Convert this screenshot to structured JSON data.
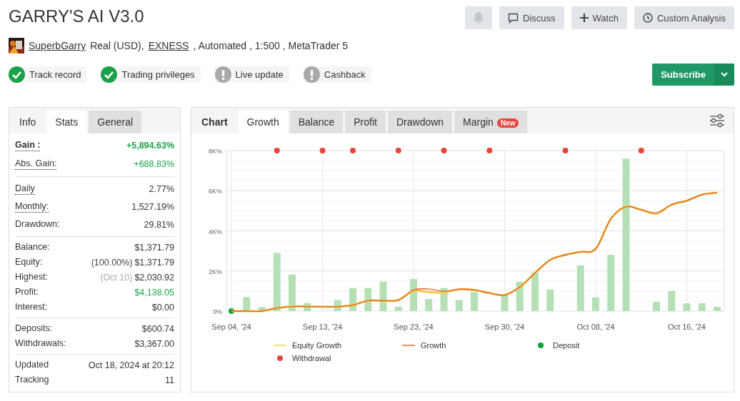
{
  "title": "GARRY'S AI V3.0",
  "header_buttons": [
    {
      "kind": "bell",
      "disabled": true
    },
    {
      "kind": "discuss",
      "label": "Discuss",
      "disabled": false
    },
    {
      "kind": "watch",
      "label": "Watch",
      "disabled": false
    },
    {
      "kind": "analysis",
      "label": "Custom Analysis",
      "disabled": false
    }
  ],
  "account": {
    "parts": [
      {
        "text": "SuperbGarry",
        "link": true
      },
      {
        "text": "Real (USD),",
        "link": false
      },
      {
        "text": "EXNESS",
        "link": true
      },
      {
        "text": ", Automated , 1:500 , MetaTrader 5",
        "link": false
      }
    ]
  },
  "badges": [
    {
      "label": "Track record",
      "verified": true
    },
    {
      "label": "Trading privileges",
      "verified": true
    },
    {
      "label": "Live update",
      "verified": false
    },
    {
      "label": "Cashback",
      "verified": false
    }
  ],
  "subscribe_button": {
    "label": "Subscribe"
  },
  "info_panel": {
    "title": "Info",
    "tabs": [
      {
        "label": "Stats",
        "selected": true
      },
      {
        "label": "General",
        "selected": false
      }
    ],
    "groups": [
      [
        {
          "label": "Gain :",
          "value": "+5,894.63%",
          "underlined": true,
          "emphasis": true,
          "positive": true
        },
        {
          "label": "Abs. Gain:",
          "value": "+688.83%",
          "underlined": true,
          "emphasis": false,
          "positive": true
        }
      ],
      [
        {
          "label": "Daily",
          "value": "2.77%",
          "underlined": true,
          "emphasis": false,
          "positive": false
        },
        {
          "label": "Monthly:",
          "value": "1,527.19%",
          "underlined": true,
          "emphasis": false,
          "positive": false
        },
        {
          "label": "Drawdown:",
          "value": "29.81%",
          "underlined": false,
          "emphasis": false,
          "positive": false
        }
      ],
      [
        {
          "label": "Balance:",
          "value": "$1,371.79",
          "underlined": false,
          "emphasis": false,
          "positive": false
        },
        {
          "label": "Equity:",
          "note": "(100.00%)",
          "note_muted": false,
          "value": "$1,371.79",
          "underlined": false,
          "emphasis": false,
          "positive": false
        },
        {
          "label": "Highest:",
          "note": "(Oct 10)",
          "note_muted": true,
          "value": "$2,030.92",
          "underlined": false,
          "emphasis": false,
          "positive": false
        },
        {
          "label": "Profit:",
          "value": "$4,138.05",
          "underlined": false,
          "emphasis": false,
          "positive": true
        },
        {
          "label": "Interest:",
          "value": "$0.00",
          "underlined": false,
          "emphasis": false,
          "positive": false
        }
      ],
      [
        {
          "label": "Deposits:",
          "value": "$600.74",
          "underlined": false,
          "emphasis": false,
          "positive": false
        },
        {
          "label": "Withdrawals:",
          "value": "$3,367.00",
          "underlined": false,
          "emphasis": false,
          "positive": false
        }
      ],
      [
        {
          "label": "Updated",
          "value": "Oct 18, 2024 at 20:12",
          "underlined": false,
          "emphasis": false,
          "positive": false
        },
        {
          "label": "Tracking",
          "value": "11",
          "underlined": false,
          "emphasis": false,
          "positive": false
        }
      ]
    ]
  },
  "chart_panel": {
    "title": "Chart",
    "tabs": [
      {
        "label": "Growth",
        "selected": true
      },
      {
        "label": "Balance",
        "selected": false
      },
      {
        "label": "Profit",
        "selected": false
      },
      {
        "label": "Drawdown",
        "selected": false
      },
      {
        "label": "Margin",
        "selected": false,
        "badge": "New"
      }
    ],
    "chart_data": {
      "type": "line",
      "grid": true,
      "legend": "bottom",
      "categories": [
        "Sep 04, '24",
        null,
        null,
        null,
        null,
        null,
        "Sep 13, '24",
        null,
        null,
        null,
        null,
        null,
        "Sep 23, '24",
        null,
        null,
        null,
        null,
        null,
        "Sep 30, '24",
        null,
        null,
        null,
        null,
        null,
        "Oct 08, '24",
        null,
        null,
        null,
        null,
        null,
        "Oct 16, '24",
        null,
        null
      ],
      "ylim": [
        0,
        8000
      ],
      "yticks": [
        {
          "value": 0,
          "label": "0%"
        },
        {
          "value": 2000,
          "label": "2K%"
        },
        {
          "value": 4000,
          "label": "4K%"
        },
        {
          "value": 6000,
          "label": "6K%"
        },
        {
          "value": 8000,
          "label": "8K%"
        }
      ],
      "series": [
        {
          "type": "bar",
          "color": "#b5e0b5",
          "values": [
            null,
            700,
            200,
            2900,
            1820,
            400,
            null,
            550,
            1150,
            1150,
            1470,
            220,
            1600,
            600,
            1150,
            550,
            950,
            null,
            800,
            1460,
            1920,
            1070,
            null,
            2280,
            680,
            2810,
            7600,
            null,
            460,
            1000,
            390,
            390,
            210
          ]
        },
        {
          "name": "Equity Growth",
          "type": "line",
          "color": "#f2c94c",
          "values": [
            0,
            0,
            0,
            150,
            230,
            230,
            220,
            220,
            300,
            520,
            520,
            550,
            1000,
            950,
            920,
            1080,
            1050,
            900,
            800,
            1200,
            1900,
            2550,
            2800,
            2950,
            3100,
            4600,
            5200,
            5050,
            4850,
            5300,
            5500,
            5800,
            5900
          ]
        },
        {
          "name": "Growth",
          "type": "line",
          "color": "#e0622a",
          "values": [
            0,
            0,
            0,
            150,
            230,
            230,
            220,
            220,
            300,
            520,
            520,
            550,
            1050,
            1100,
            980,
            1100,
            1050,
            900,
            800,
            1200,
            1900,
            2550,
            2800,
            2950,
            3100,
            4600,
            5200,
            5050,
            4900,
            5300,
            5500,
            5800,
            5900
          ]
        },
        {
          "name": "Deposit",
          "type": "scatter",
          "color": "#0aa23a",
          "values": [
            0,
            null,
            null,
            null,
            null,
            null,
            null,
            null,
            null,
            null,
            null,
            null,
            null,
            null,
            null,
            null,
            null,
            null,
            null,
            null,
            null,
            null,
            null,
            null,
            null,
            null,
            null,
            null,
            null,
            null,
            null,
            null,
            null
          ]
        },
        {
          "name": "Withdrawal",
          "type": "scatter",
          "color": "#e8443a",
          "values": [
            null,
            null,
            null,
            8000,
            null,
            null,
            8000,
            null,
            8000,
            null,
            null,
            8000,
            null,
            null,
            8000,
            null,
            null,
            8000,
            null,
            null,
            null,
            null,
            8000,
            null,
            null,
            null,
            null,
            8000,
            null,
            null,
            null,
            null,
            null
          ]
        }
      ]
    }
  }
}
